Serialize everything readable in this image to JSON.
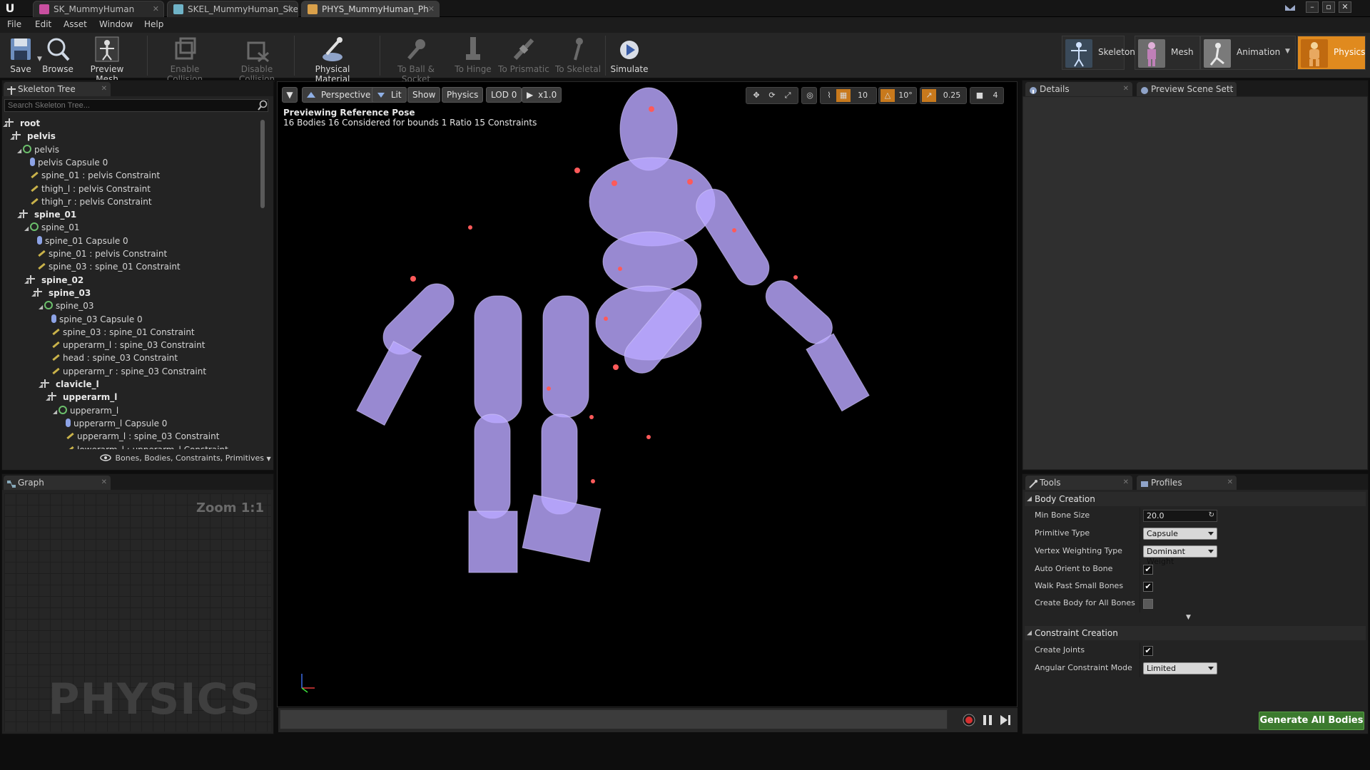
{
  "tabs": [
    {
      "label": "SK_MummyHuman",
      "color": "#c94fa0"
    },
    {
      "label": "SKEL_MummyHuman_Ske",
      "color": "#6fb3c7"
    },
    {
      "label": "PHYS_MummyHuman_Ph",
      "color": "#d9a04a"
    }
  ],
  "menu": [
    "File",
    "Edit",
    "Asset",
    "Window",
    "Help"
  ],
  "toolbar": {
    "save": "Save",
    "browse": "Browse",
    "preview_mesh": "Preview Mesh",
    "enable_collision": "Enable Collision",
    "disable_collision": "Disable Collision",
    "physical_material": "Physical Material",
    "to_ball_socket": "To Ball & Socket",
    "to_hinge": "To Hinge",
    "to_prismatic": "To Prismatic",
    "to_skeletal": "To Skeletal",
    "simulate": "Simulate"
  },
  "modes": {
    "skeleton": "Skeleton",
    "mesh": "Mesh",
    "animation": "Animation",
    "physics": "Physics"
  },
  "skeleton_tree": {
    "tab": "Skeleton Tree",
    "search_placeholder": "Search Skeleton Tree...",
    "rows": [
      {
        "text": "root",
        "kind": "bone",
        "indent": 0
      },
      {
        "text": "pelvis",
        "kind": "bone",
        "indent": 1
      },
      {
        "text": "pelvis",
        "kind": "body",
        "indent": 2
      },
      {
        "text": "pelvis Capsule 0",
        "kind": "cap",
        "indent": 3
      },
      {
        "text": "spine_01 : pelvis Constraint",
        "kind": "con",
        "indent": 3
      },
      {
        "text": "thigh_l : pelvis Constraint",
        "kind": "con",
        "indent": 3
      },
      {
        "text": "thigh_r : pelvis Constraint",
        "kind": "con",
        "indent": 3
      },
      {
        "text": "spine_01",
        "kind": "bone",
        "indent": 2
      },
      {
        "text": "spine_01",
        "kind": "body",
        "indent": 3
      },
      {
        "text": "spine_01 Capsule 0",
        "kind": "cap",
        "indent": 4
      },
      {
        "text": "spine_01 : pelvis Constraint",
        "kind": "con",
        "indent": 4
      },
      {
        "text": "spine_03 : spine_01 Constraint",
        "kind": "con",
        "indent": 4
      },
      {
        "text": "spine_02",
        "kind": "bone",
        "indent": 3
      },
      {
        "text": "spine_03",
        "kind": "bone",
        "indent": 4
      },
      {
        "text": "spine_03",
        "kind": "body",
        "indent": 5
      },
      {
        "text": "spine_03 Capsule 0",
        "kind": "cap",
        "indent": 6
      },
      {
        "text": "spine_03 : spine_01 Constraint",
        "kind": "con",
        "indent": 6
      },
      {
        "text": "upperarm_l : spine_03 Constraint",
        "kind": "con",
        "indent": 6
      },
      {
        "text": "head : spine_03 Constraint",
        "kind": "con",
        "indent": 6
      },
      {
        "text": "upperarm_r : spine_03 Constraint",
        "kind": "con",
        "indent": 6
      },
      {
        "text": "clavicle_l",
        "kind": "bone",
        "indent": 5
      },
      {
        "text": "upperarm_l",
        "kind": "bone",
        "indent": 6
      },
      {
        "text": "upperarm_l",
        "kind": "body",
        "indent": 7
      },
      {
        "text": "upperarm_l Capsule 0",
        "kind": "cap",
        "indent": 8
      },
      {
        "text": "upperarm_l : spine_03 Constraint",
        "kind": "con",
        "indent": 8
      },
      {
        "text": "lowerarm_l : upperarm_l Constraint",
        "kind": "con",
        "indent": 8
      }
    ],
    "filter_label": "Bones, Bodies, Constraints, Primitives"
  },
  "graph": {
    "tab": "Graph",
    "zoom": "Zoom 1:1",
    "watermark": "PHYSICS"
  },
  "viewport": {
    "perspective": "Perspective",
    "lit": "Lit",
    "show": "Show",
    "physics": "Physics",
    "lod": "LOD 0",
    "speed": "x1.0",
    "grid_snap": "10",
    "rot_snap": "10°",
    "scale_snap": "0.25",
    "cam_speed": "4",
    "info_title": "Previewing Reference Pose",
    "info_stats": "16 Bodies  16 Considered for bounds  1 Ratio  15 Constraints"
  },
  "details": {
    "tab": "Details",
    "tab2": "Preview Scene Sett"
  },
  "tools": {
    "tab": "Tools",
    "tab2": "Profiles",
    "body_creation": "Body Creation",
    "min_bone_size_label": "Min Bone Size",
    "min_bone_size": "20.0",
    "primitive_type_label": "Primitive Type",
    "primitive_type": "Capsule",
    "vertex_weighting_label": "Vertex Weighting Type",
    "vertex_weighting": "Dominant Weight",
    "auto_orient_label": "Auto Orient to Bone",
    "auto_orient": true,
    "walk_past_label": "Walk Past Small Bones",
    "walk_past": true,
    "create_all_label": "Create Body for All Bones",
    "create_all": false,
    "constraint_creation": "Constraint Creation",
    "create_joints_label": "Create Joints",
    "create_joints": true,
    "angular_mode_label": "Angular Constraint Mode",
    "angular_mode": "Limited",
    "generate": "Generate All Bodies"
  },
  "colors": {
    "body": "#b9a7ff",
    "accent": "#e08a1e",
    "generate": "#3b7a2e"
  }
}
